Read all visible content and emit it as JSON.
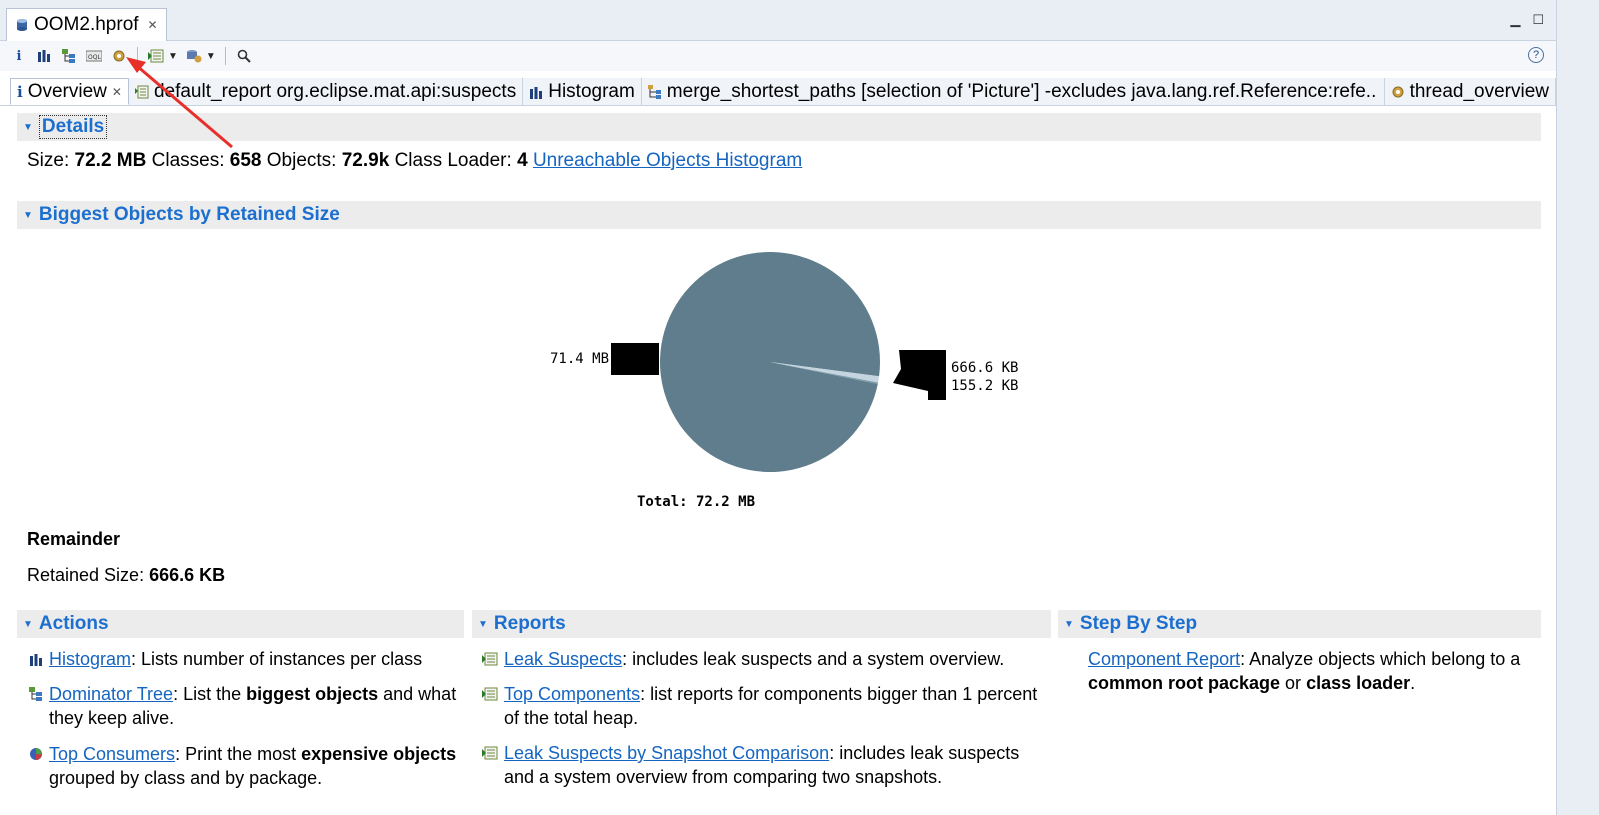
{
  "editor_tab": {
    "title": "OOM2.hprof"
  },
  "toolbar": {
    "buttons": [
      "info-icon",
      "histogram-icon",
      "dominator-tree-icon",
      "oql-icon",
      "thread-overview-icon",
      "run-report-icon",
      "heap-dump-icon",
      "search-icon"
    ],
    "help": "?"
  },
  "tabs": [
    {
      "label": "Overview",
      "icon": "info-icon",
      "active": true
    },
    {
      "label": "default_report  org.eclipse.mat.api:suspects",
      "icon": "report-icon"
    },
    {
      "label": "Histogram",
      "icon": "histogram-icon"
    },
    {
      "label": "merge_shortest_paths  [selection of 'Picture'] -excludes java.lang.ref.Reference:refe...",
      "icon": "paths-icon"
    },
    {
      "label": "thread_overview",
      "icon": "thread-overview-icon"
    }
  ],
  "details": {
    "header": "Details",
    "size_label": "Size:",
    "size_value": "72.2 MB",
    "classes_label": "Classes:",
    "classes_value": "658",
    "objects_label": "Objects:",
    "objects_value": "72.9k",
    "loader_label": "Class Loader:",
    "loader_value": "4",
    "unreachable_link": "Unreachable Objects Histogram"
  },
  "biggest": {
    "header": "Biggest Objects by Retained Size",
    "total_label": "Total: 72.2 MB"
  },
  "chart_data": {
    "type": "pie",
    "values_mb": [
      71.4,
      0.6666,
      0.1552
    ],
    "labels": [
      "71.4 MB",
      "666.6 KB",
      "155.2 KB"
    ],
    "total": "Total: 72.2 MB",
    "colors": [
      "#5f7d8c",
      "#c4d5df",
      "#7d9aaa"
    ]
  },
  "remainder": {
    "title": "Remainder",
    "size_label": "Retained Size:",
    "size_value": "666.6 KB"
  },
  "actions": {
    "header": "Actions",
    "histogram_link": "Histogram",
    "histogram_text": ": Lists number of instances per class",
    "dominator_link": "Dominator Tree",
    "dominator_text1": ": List the ",
    "dominator_bold": "biggest objects",
    "dominator_text2": " and what they keep alive.",
    "consumers_link": "Top Consumers",
    "consumers_text1": ": Print the most ",
    "consumers_bold": "expensive objects",
    "consumers_text2": " grouped by class and by package."
  },
  "reports": {
    "header": "Reports",
    "leak_link": "Leak Suspects",
    "leak_text": ": includes leak suspects and a system overview.",
    "components_link": "Top Components",
    "components_text": ": list reports for components bigger than 1 percent of the total heap.",
    "comparison_link": "Leak Suspects by Snapshot Comparison",
    "comparison_text": ": includes leak suspects and a system overview from comparing two snapshots."
  },
  "step_by_step": {
    "header": "Step By Step",
    "component_link": "Component Report",
    "component_text1": ": Analyze objects which belong to a ",
    "component_bold1": "common root package",
    "component_text2": " or ",
    "component_bold2": "class loader",
    "component_text3": "."
  }
}
